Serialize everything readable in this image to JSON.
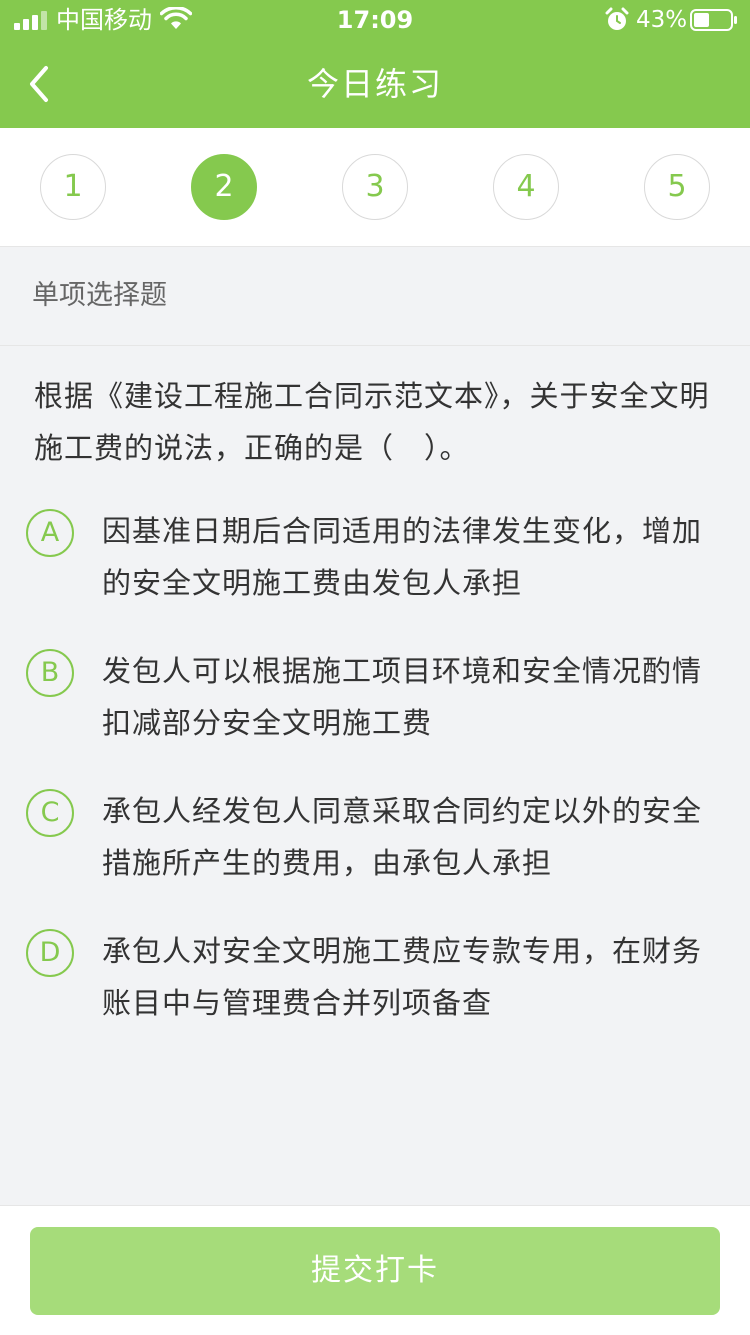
{
  "status_bar": {
    "carrier": "中国移动",
    "time": "17:09",
    "battery_percent": "43%",
    "battery_level": 0.43,
    "signal_icon": "cellular-signal-icon",
    "wifi_icon": "wifi-icon",
    "alarm_icon": "alarm-clock-icon",
    "battery_icon": "battery-icon"
  },
  "nav": {
    "title": "今日练习",
    "back_icon": "chevron-left-icon"
  },
  "question_numbers": [
    "1",
    "2",
    "3",
    "4",
    "5"
  ],
  "active_question_number": "2",
  "section": {
    "label": "单项选择题"
  },
  "question": {
    "text": "根据《建设工程施工合同示范文本》，关于安全文明施工费的说法，正确的是（　）。",
    "options": [
      {
        "letter": "A",
        "text": "因基准日期后合同适用的法律发生变化，增加的安全文明施工费由发包人承担"
      },
      {
        "letter": "B",
        "text": "发包人可以根据施工项目环境和安全情况酌情扣减部分安全文明施工费"
      },
      {
        "letter": "C",
        "text": "承包人经发包人同意采取合同约定以外的安全措施所产生的费用，由承包人承担"
      },
      {
        "letter": "D",
        "text": "承包人对安全文明施工费应专款专用，在财务账目中与管理费合并列项备查"
      }
    ]
  },
  "footer": {
    "submit_label": "提交打卡"
  },
  "colors": {
    "brand_green": "#85c94e",
    "submit_disabled": "#a6dc7a",
    "background": "#f2f3f5"
  }
}
